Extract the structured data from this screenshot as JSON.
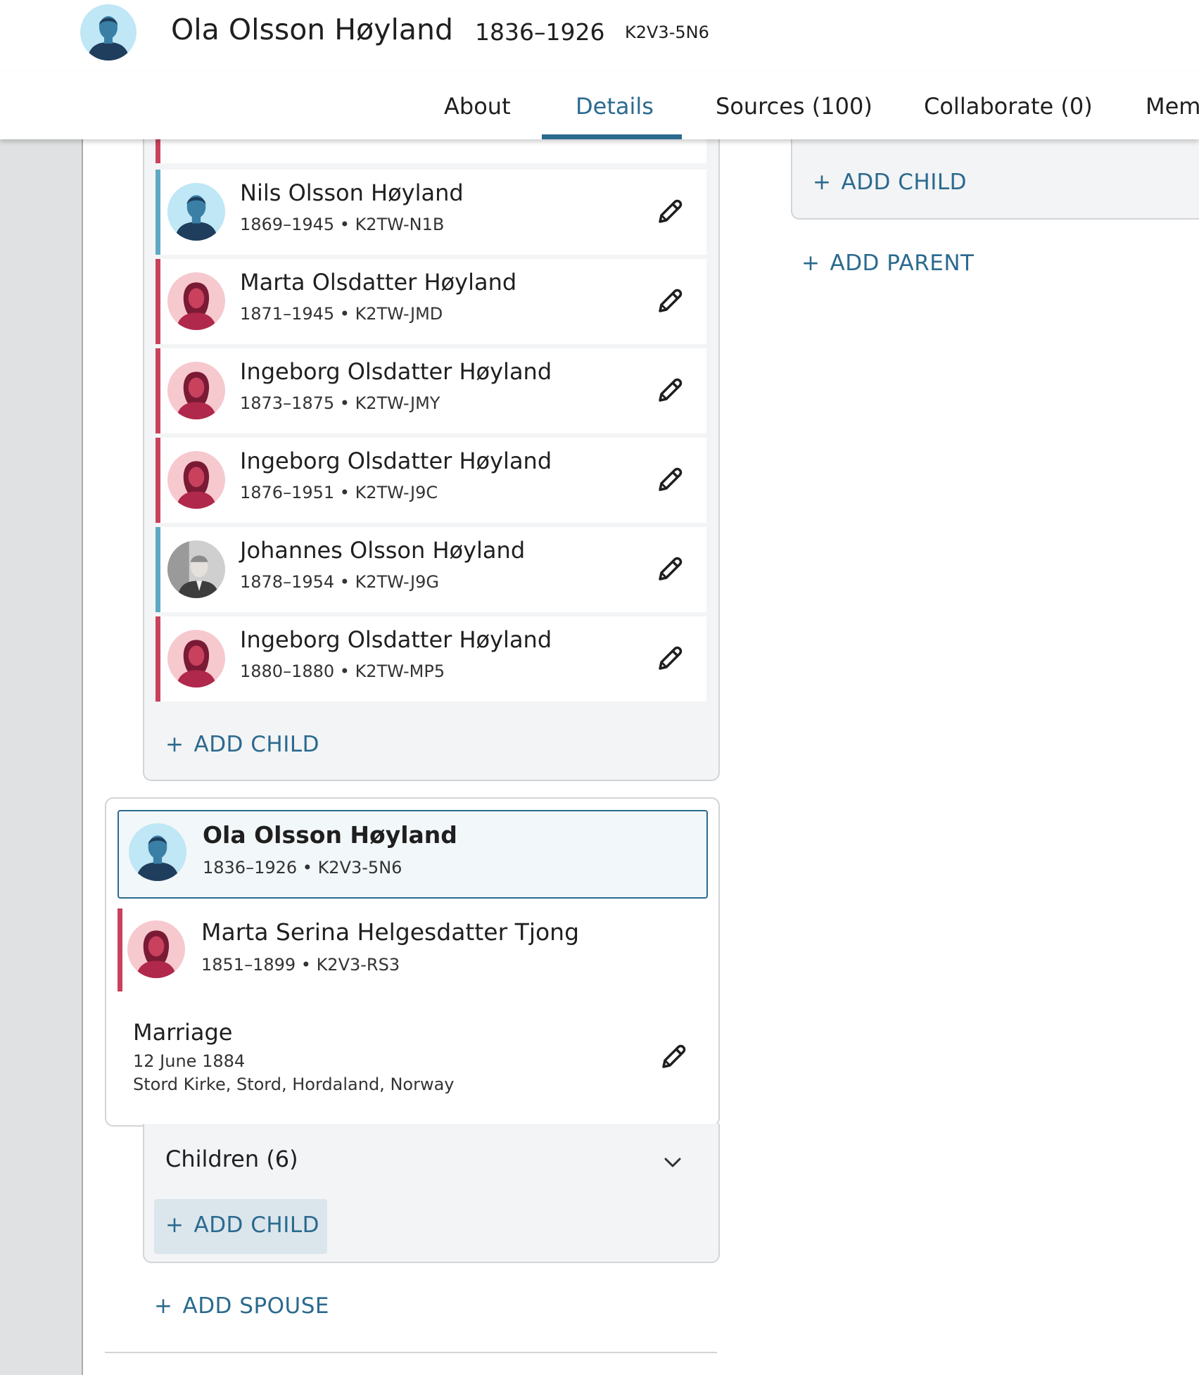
{
  "header": {
    "name": "Ola Olsson Høyland",
    "lifespan": "1836–1926",
    "pid": "K2V3-5N6"
  },
  "tabs": [
    {
      "label": "About"
    },
    {
      "label": "Details"
    },
    {
      "label": "Sources (100)"
    },
    {
      "label": "Collaborate (0)"
    },
    {
      "label": "Mem"
    }
  ],
  "children": [
    {
      "name": "Nils Olsson Høyland",
      "meta": "1869–1945 • K2TW-N1B",
      "gender": "male"
    },
    {
      "name": "Marta Olsdatter Høyland",
      "meta": "1871–1945 • K2TW-JMD",
      "gender": "female"
    },
    {
      "name": "Ingeborg Olsdatter Høyland",
      "meta": "1873–1875 • K2TW-JMY",
      "gender": "female"
    },
    {
      "name": "Ingeborg Olsdatter Høyland",
      "meta": "1876–1951 • K2TW-J9C",
      "gender": "female"
    },
    {
      "name": "Johannes Olsson Høyland",
      "meta": "1878–1954 • K2TW-J9G",
      "gender": "male-photo"
    },
    {
      "name": "Ingeborg Olsdatter Høyland",
      "meta": "1880–1880 • K2TW-MP5",
      "gender": "female"
    }
  ],
  "labels": {
    "add_child": "ADD CHILD",
    "add_parent": "ADD PARENT",
    "add_spouse": "ADD SPOUSE",
    "plus": "+"
  },
  "couple": {
    "focus": {
      "name": "Ola Olsson Høyland",
      "meta": "1836–1926 • K2V3-5N6"
    },
    "spouse": {
      "name": "Marta Serina Helgesdatter Tjong",
      "meta": "1851–1899 • K2V3-RS3"
    },
    "marriage": {
      "title": "Marriage",
      "date": "12 June 1884",
      "place": "Stord Kirke, Stord, Hordaland, Norway"
    },
    "children_toggle": "Children (6)"
  },
  "colors": {
    "accent": "#2b6a8f",
    "male": "#5ea8c4",
    "female": "#c9415d"
  }
}
